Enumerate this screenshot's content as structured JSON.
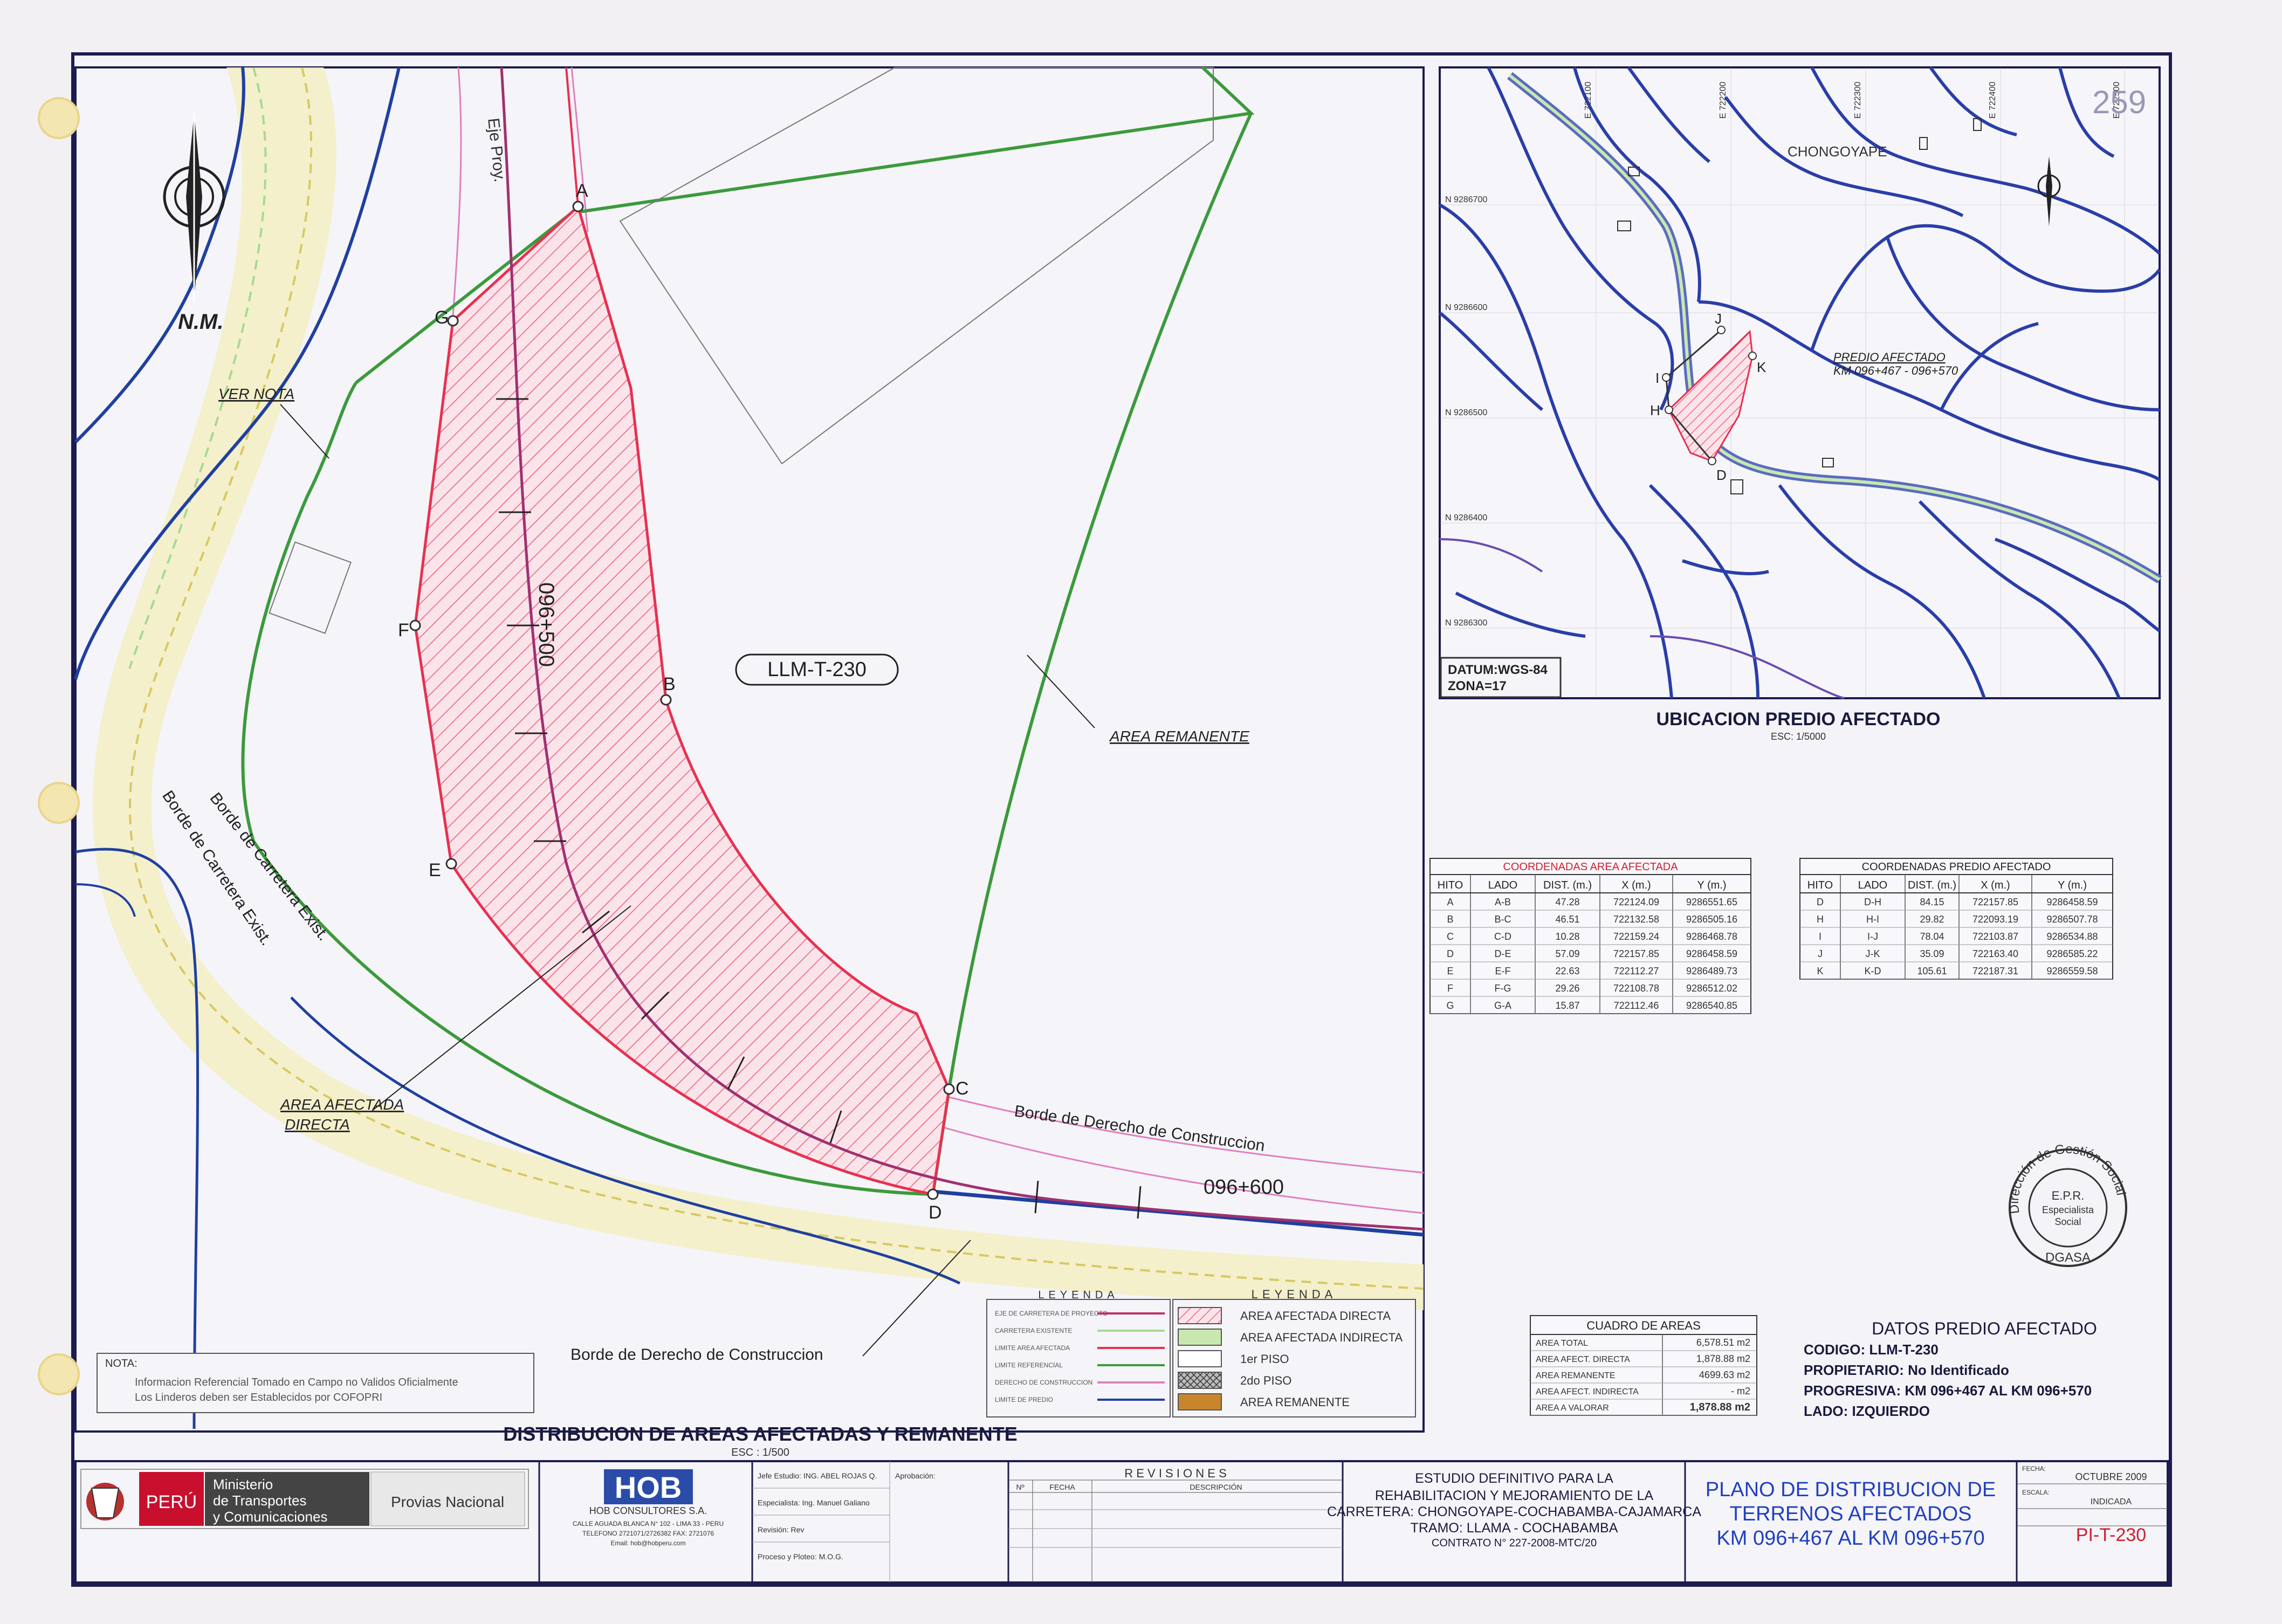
{
  "sheet_number": "259",
  "plan": {
    "north": "N.M.",
    "axis_label": "Eje Proy.",
    "ver_nota": "VER NOTA",
    "code_label": "LLM-T-230",
    "area_remanente": "AREA REMANENTE",
    "area_afectada_line1": "AREA AFECTADA",
    "area_afectada_line2": "DIRECTA",
    "borde_carretera_1": "Borde de Carretera Exist.",
    "borde_carretera_2": "Borde de Carretera Exist.",
    "borde_derecho_1": "Borde de Derecho de Construccion",
    "borde_derecho_2": "Borde de Derecho de Construccion",
    "station_500": "096+500",
    "station_600": "096+600",
    "points": {
      "A": "A",
      "B": "B",
      "C": "C",
      "D": "D",
      "E": "E",
      "F": "F",
      "G": "G"
    },
    "title": "DISTRIBUCION DE AREAS AFECTADAS Y REMANENTE",
    "scale": "ESC : 1/500"
  },
  "nota": {
    "label": "NOTA:",
    "line1": "Informacion Referencial Tomado en Campo no Validos Oficialmente",
    "line2": "Los Linderos deben ser Establecidos por COFOPRI"
  },
  "leyenda_lines": {
    "title": "LEYENDA",
    "items": [
      {
        "label": "EJE DE CARRETERA DE PROYECTO",
        "color": "#c0306a"
      },
      {
        "label": "CARRETERA EXISTENTE",
        "color": "#a8d890"
      },
      {
        "label": "LIMITE AREA AFECTADA",
        "color": "#e83050"
      },
      {
        "label": "LIMITE REFERENCIAL",
        "color": "#3c9a3c"
      },
      {
        "label": "DERECHO DE CONSTRUCCION",
        "color": "#e080c0"
      },
      {
        "label": "LIMITE DE PREDIO",
        "color": "#2040a0"
      }
    ]
  },
  "leyenda_areas": {
    "title": "LEYENDA",
    "items": [
      {
        "label": "AREA AFECTADA DIRECTA",
        "color": "#f8b8c8"
      },
      {
        "label": "AREA AFECTADA INDIRECTA",
        "color": "#c8e8b0"
      },
      {
        "label": "1er PISO",
        "color": "#ffffff"
      },
      {
        "label": "2do PISO",
        "color": "#999999"
      },
      {
        "label": "AREA REMANENTE",
        "color": "#c8862c"
      }
    ]
  },
  "location": {
    "town": "CHONGOYAPE",
    "predio_line1": "PREDIO AFECTADO",
    "predio_line2": "KM 096+467 - 096+570",
    "datum_line1": "DATUM:WGS-84",
    "datum_line2": "ZONA=17",
    "title": "UBICACION PREDIO AFECTADO",
    "scale": "ESC: 1/5000",
    "grid_e": [
      "E 722100",
      "E 722200",
      "E 722300",
      "E 722400",
      "E 722500"
    ],
    "grid_n": [
      "N 9286700",
      "N 9286600",
      "N 9286500",
      "N 9286400",
      "N 9286300"
    ],
    "hitos": [
      "H",
      "I",
      "J",
      "K",
      "D"
    ]
  },
  "coord_afectada": {
    "title": "COORDENADAS AREA AFECTADA",
    "headers": [
      "HITO",
      "LADO",
      "DIST. (m.)",
      "X (m.)",
      "Y (m.)"
    ],
    "rows": [
      [
        "A",
        "A-B",
        "47.28",
        "722124.09",
        "9286551.65"
      ],
      [
        "B",
        "B-C",
        "46.51",
        "722132.58",
        "9286505.16"
      ],
      [
        "C",
        "C-D",
        "10.28",
        "722159.24",
        "9286468.78"
      ],
      [
        "D",
        "D-E",
        "57.09",
        "722157.85",
        "9286458.59"
      ],
      [
        "E",
        "E-F",
        "22.63",
        "722112.27",
        "9286489.73"
      ],
      [
        "F",
        "F-G",
        "29.26",
        "722108.78",
        "9286512.02"
      ],
      [
        "G",
        "G-A",
        "15.87",
        "722112.46",
        "9286540.85"
      ]
    ]
  },
  "coord_predio": {
    "title": "COORDENADAS PREDIO AFECTADO",
    "headers": [
      "HITO",
      "LADO",
      "DIST. (m.)",
      "X (m.)",
      "Y (m.)"
    ],
    "rows": [
      [
        "D",
        "D-H",
        "84.15",
        "722157.85",
        "9286458.59"
      ],
      [
        "H",
        "H-I",
        "29.82",
        "722093.19",
        "9286507.78"
      ],
      [
        "I",
        "I-J",
        "78.04",
        "722103.87",
        "9286534.88"
      ],
      [
        "J",
        "J-K",
        "35.09",
        "722163.40",
        "9286585.22"
      ],
      [
        "K",
        "K-D",
        "105.61",
        "722187.31",
        "9286559.58"
      ]
    ]
  },
  "cuadro": {
    "title": "CUADRO DE AREAS",
    "rows": [
      [
        "AREA TOTAL",
        "6,578.51 m2"
      ],
      [
        "AREA AFECT. DIRECTA",
        "1,878.88 m2"
      ],
      [
        "AREA REMANENTE",
        "4699.63 m2"
      ],
      [
        "AREA AFECT. INDIRECTA",
        "- m2"
      ],
      [
        "AREA A VALORAR",
        "1,878.88 m2"
      ]
    ]
  },
  "datos": {
    "title": "DATOS PREDIO AFECTADO",
    "codigo": "CODIGO: LLM-T-230",
    "propietario": "PROPIETARIO: No Identificado",
    "progresiva": "PROGRESIVA: KM 096+467 AL KM 096+570",
    "lado": "LADO: IZQUIERDO"
  },
  "stamp": {
    "ring_top": "Dirección de Gestión Social",
    "center1": "E.P.R.",
    "center2": "Especialista",
    "center3": "Social",
    "bottom": "DGASA"
  },
  "titleblock": {
    "peru": "PERÚ",
    "ministerio1": "Ministerio",
    "ministerio2": "de Transportes",
    "ministerio3": "y Comunicaciones",
    "provias": "Provias Nacional",
    "hob": "HOB",
    "hob_name": "HOB CONSULTORES S.A.",
    "hob_addr1": "CALLE AGUADA BLANCA N° 102 - LIMA 33 - PERU",
    "hob_addr2": "TELEFONO 2721071/2726382 FAX: 2721076",
    "hob_addr3": "Email: hob@hobperu.com",
    "jefe": "Jefe Estudio: ING. ABEL ROJAS Q.",
    "especialista": "Especialista: Ing. Manuel Galiano",
    "revision": "Revisión: Rev",
    "proceso": "Proceso y Ploteo: M.O.G.",
    "aprobacion": "Aprobación:",
    "revisiones": "R E V I S I O N E S",
    "rev_no": "Nº",
    "rev_fecha": "FECHA",
    "rev_desc": "DESCRIPCIÓN",
    "proj1": "ESTUDIO DEFINITIVO PARA LA",
    "proj2": "REHABILITACION Y MEJORAMIENTO DE LA",
    "proj3": "CARRETERA: CHONGOYAPE-COCHABAMBA-CAJAMARCA",
    "proj4": "TRAMO: LLAMA - COCHABAMBA",
    "proj5": "CONTRATO N° 227-2008-MTC/20",
    "plano1": "PLANO DE DISTRIBUCION DE",
    "plano2": "TERRENOS AFECTADOS",
    "plano3": "KM 096+467 AL KM 096+570",
    "fecha_label": "FECHA:",
    "fecha": "OCTUBRE 2009",
    "escala_label": "ESCALA:",
    "escala": "INDICADA",
    "lamina": "PI-T-230"
  }
}
